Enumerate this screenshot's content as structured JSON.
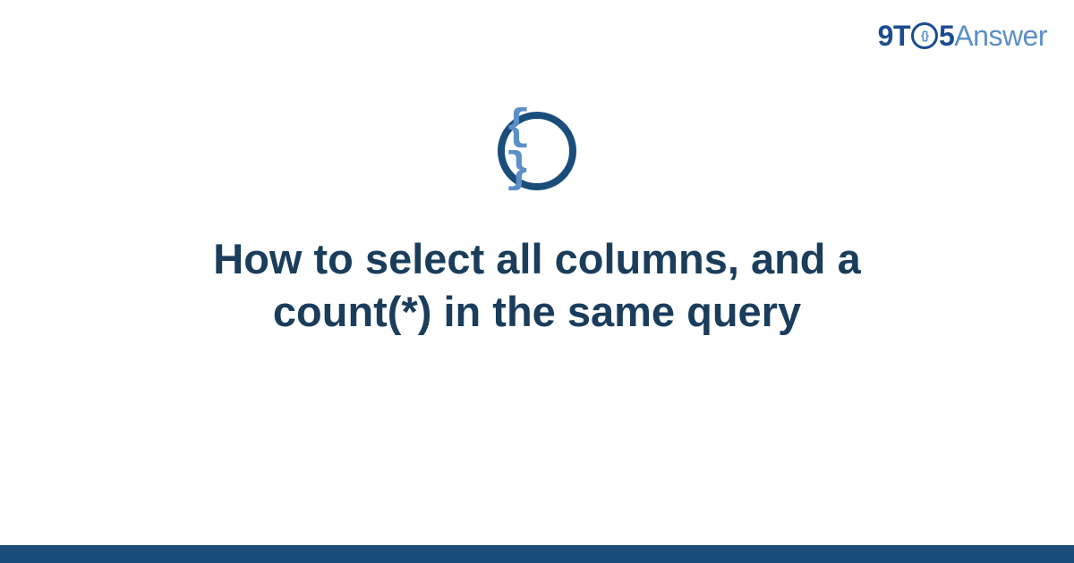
{
  "logo": {
    "part1": "9T",
    "part2_inner": "{}",
    "part3": "5",
    "part4": "Answer"
  },
  "icon": {
    "name": "code-braces-icon",
    "glyph": "{ }"
  },
  "title": "How to select all columns, and a count(*) in the same query",
  "colors": {
    "primary_dark": "#1a4d7a",
    "primary_blue": "#1a4d8f",
    "secondary_blue": "#5b8fc7",
    "title_color": "#1a3d5c"
  }
}
